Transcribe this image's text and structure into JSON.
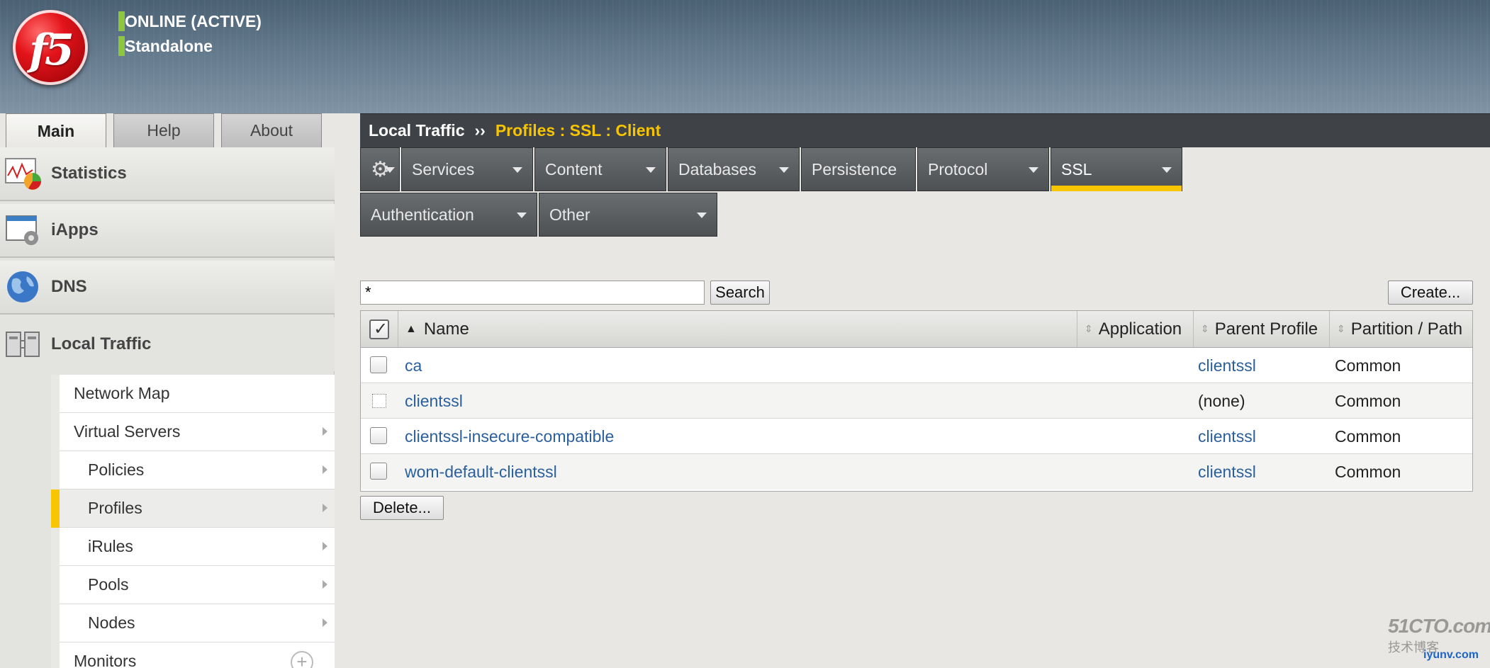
{
  "header": {
    "logo_text": "f5",
    "status_line1": "ONLINE (ACTIVE)",
    "status_line2": "Standalone",
    "status_color": "#8dc63f"
  },
  "top_tabs": [
    {
      "label": "Main",
      "active": true
    },
    {
      "label": "Help",
      "active": false
    },
    {
      "label": "About",
      "active": false
    }
  ],
  "sidebar": {
    "sections": [
      {
        "label": "Statistics",
        "icon": "statistics-icon"
      },
      {
        "label": "iApps",
        "icon": "iapps-icon"
      },
      {
        "label": "DNS",
        "icon": "dns-globe-icon"
      },
      {
        "label": "Local Traffic",
        "icon": "local-traffic-icon"
      }
    ],
    "local_traffic_items": [
      {
        "label": "Network Map"
      },
      {
        "label": "Virtual Servers"
      },
      {
        "label": "Policies"
      },
      {
        "label": "Profiles",
        "selected": true
      },
      {
        "label": "iRules"
      },
      {
        "label": "Pools"
      },
      {
        "label": "Nodes"
      },
      {
        "label": "Monitors"
      }
    ]
  },
  "breadcrumb": {
    "root": "Local Traffic",
    "separator": "››",
    "current": "Profiles : SSL : Client"
  },
  "nav_menu": {
    "items": [
      {
        "label": "Services"
      },
      {
        "label": "Content"
      },
      {
        "label": "Databases"
      },
      {
        "label": "Persistence"
      },
      {
        "label": "Protocol"
      },
      {
        "label": "SSL",
        "active": true
      },
      {
        "label": "Authentication"
      },
      {
        "label": "Other"
      }
    ],
    "active_color": "#f7c600"
  },
  "toolbar": {
    "search_value": "*",
    "search_label": "Search",
    "create_label": "Create...",
    "delete_label": "Delete..."
  },
  "table": {
    "columns": [
      "Name",
      "Application",
      "Parent Profile",
      "Partition / Path"
    ],
    "rows": [
      {
        "name": "ca",
        "application": "",
        "parent": "clientssl",
        "partition": "Common"
      },
      {
        "name": "clientssl",
        "application": "",
        "parent": "(none)",
        "partition": "Common"
      },
      {
        "name": "clientssl-insecure-compatible",
        "application": "",
        "parent": "clientssl",
        "partition": "Common"
      },
      {
        "name": "wom-default-clientssl",
        "application": "",
        "parent": "clientssl",
        "partition": "Common"
      }
    ]
  },
  "watermark": {
    "line1": "51CTO.com",
    "line2": "技术博客",
    "line3": "iyunv.com"
  }
}
